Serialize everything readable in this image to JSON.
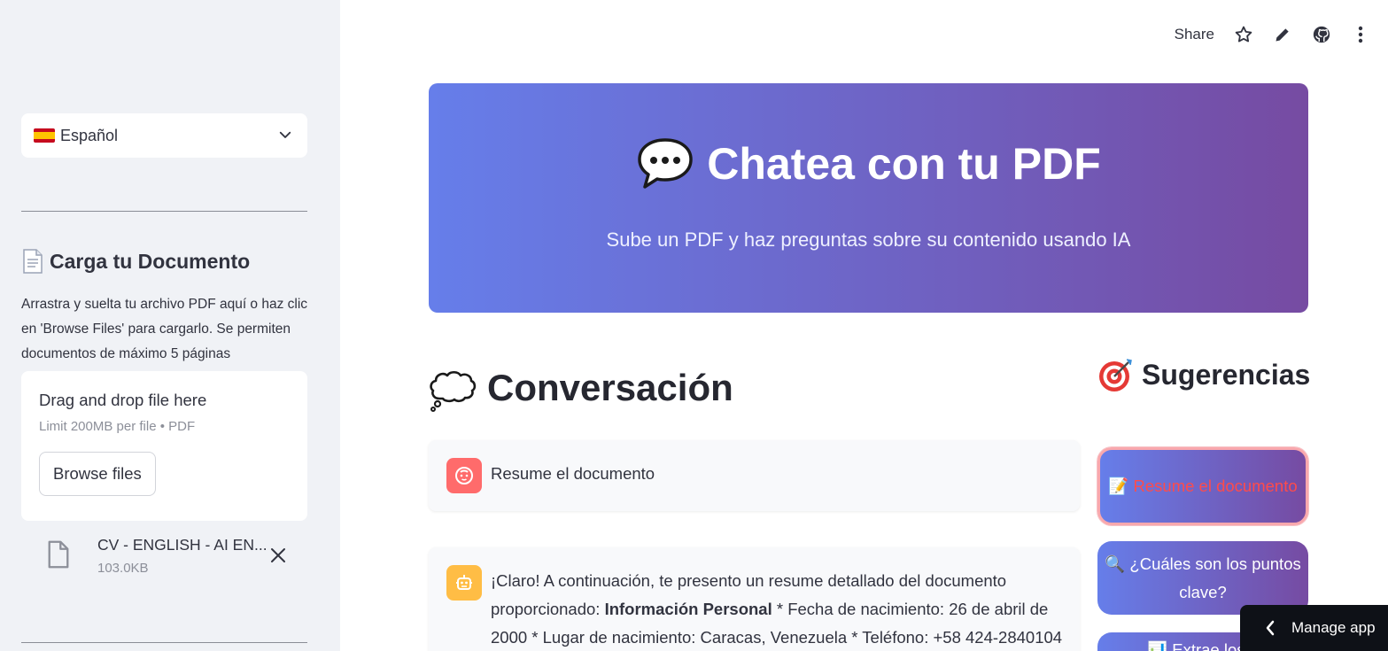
{
  "sidebar": {
    "language": {
      "selected": "Español",
      "flag": "spain-flag"
    },
    "upload": {
      "title": "Carga tu Documento",
      "description": "Arrastra y suelta tu archivo PDF aquí o haz clic en 'Browse Files' para cargarlo. Se permiten documentos de máximo 5 páginas",
      "dropzone_title": "Drag and drop file here",
      "dropzone_limit": "Limit 200MB per file • PDF",
      "browse_label": "Browse files"
    },
    "file": {
      "name": "CV - ENGLISH - AI EN...",
      "size": "103.0KB"
    }
  },
  "toolbar": {
    "share_label": "Share",
    "icons": [
      "star-icon",
      "pencil-icon",
      "github-icon",
      "more-vertical-icon"
    ]
  },
  "hero": {
    "title": "Chatea con tu PDF",
    "subtitle": "Sube un PDF y haz preguntas sobre su contenido usando IA",
    "gradient": [
      "#667eea",
      "#764ba2"
    ]
  },
  "conversation": {
    "title": "Conversación",
    "messages": [
      {
        "role": "user",
        "text": "Resume el documento"
      },
      {
        "role": "assistant",
        "text_before": "¡Claro! A continuación, te presento un resume detallado del documento proporcionado: ",
        "bold": "Información Personal",
        "text_after": " * Fecha de nacimiento: 26 de abril de 2000 * Lugar de nacimiento: Caracas, Venezuela * Teléfono: +58 424-2840104"
      }
    ]
  },
  "suggestions": {
    "title": "Sugerencias",
    "items": [
      {
        "label": "📝 Resume el documento"
      },
      {
        "label": "🔍 ¿Cuáles son los puntos clave?"
      },
      {
        "label": "📊 Extrae los..."
      }
    ]
  },
  "manage_app": {
    "label": "Manage app"
  },
  "colors": {
    "sidebar_bg": "#f0f2f6",
    "accent_red": "#ff4b4b",
    "user_avatar": "#ff6b6b",
    "bot_avatar": "#ffbd45"
  }
}
